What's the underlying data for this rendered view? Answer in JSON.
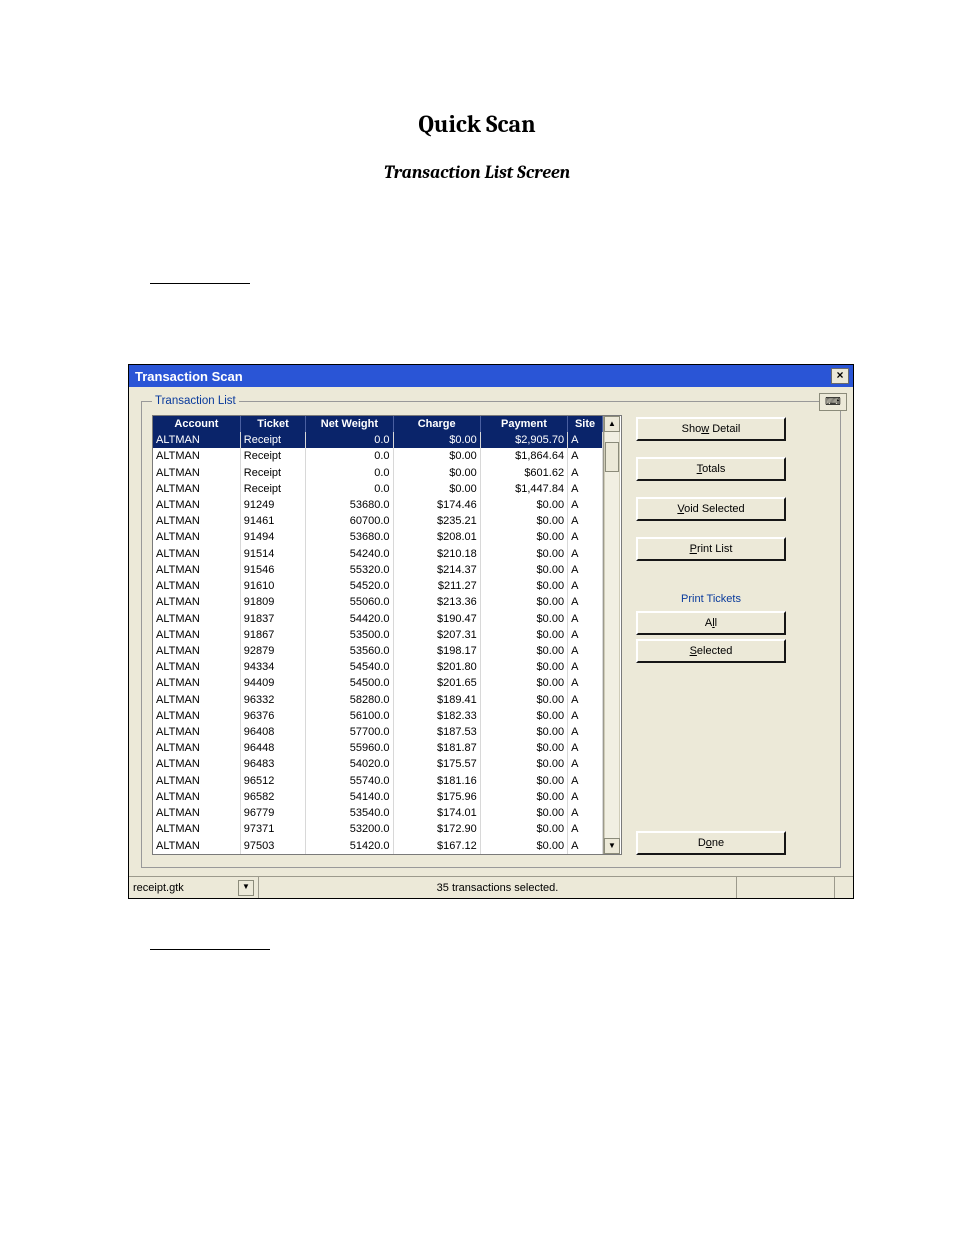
{
  "doc": {
    "title": "Quick Scan",
    "subtitle": "Transaction List Screen"
  },
  "window": {
    "title": "Transaction Scan",
    "close": "×",
    "corner_icon": "⌨"
  },
  "fieldset": {
    "legend": "Transaction List"
  },
  "columns": {
    "account": "Account",
    "ticket": "Ticket",
    "net_weight": "Net Weight",
    "charge": "Charge",
    "payment": "Payment",
    "site": "Site"
  },
  "rows": [
    {
      "account": "ALTMAN",
      "ticket": "Receipt",
      "net_weight": "0.0",
      "charge": "$0.00",
      "payment": "$2,905.70",
      "site": "A",
      "selected": true
    },
    {
      "account": "ALTMAN",
      "ticket": "Receipt",
      "net_weight": "0.0",
      "charge": "$0.00",
      "payment": "$1,864.64",
      "site": "A"
    },
    {
      "account": "ALTMAN",
      "ticket": "Receipt",
      "net_weight": "0.0",
      "charge": "$0.00",
      "payment": "$601.62",
      "site": "A"
    },
    {
      "account": "ALTMAN",
      "ticket": "Receipt",
      "net_weight": "0.0",
      "charge": "$0.00",
      "payment": "$1,447.84",
      "site": "A"
    },
    {
      "account": "ALTMAN",
      "ticket": "91249",
      "net_weight": "53680.0",
      "charge": "$174.46",
      "payment": "$0.00",
      "site": "A"
    },
    {
      "account": "ALTMAN",
      "ticket": "91461",
      "net_weight": "60700.0",
      "charge": "$235.21",
      "payment": "$0.00",
      "site": "A"
    },
    {
      "account": "ALTMAN",
      "ticket": "91494",
      "net_weight": "53680.0",
      "charge": "$208.01",
      "payment": "$0.00",
      "site": "A"
    },
    {
      "account": "ALTMAN",
      "ticket": "91514",
      "net_weight": "54240.0",
      "charge": "$210.18",
      "payment": "$0.00",
      "site": "A"
    },
    {
      "account": "ALTMAN",
      "ticket": "91546",
      "net_weight": "55320.0",
      "charge": "$214.37",
      "payment": "$0.00",
      "site": "A"
    },
    {
      "account": "ALTMAN",
      "ticket": "91610",
      "net_weight": "54520.0",
      "charge": "$211.27",
      "payment": "$0.00",
      "site": "A"
    },
    {
      "account": "ALTMAN",
      "ticket": "91809",
      "net_weight": "55060.0",
      "charge": "$213.36",
      "payment": "$0.00",
      "site": "A"
    },
    {
      "account": "ALTMAN",
      "ticket": "91837",
      "net_weight": "54420.0",
      "charge": "$190.47",
      "payment": "$0.00",
      "site": "A"
    },
    {
      "account": "ALTMAN",
      "ticket": "91867",
      "net_weight": "53500.0",
      "charge": "$207.31",
      "payment": "$0.00",
      "site": "A"
    },
    {
      "account": "ALTMAN",
      "ticket": "92879",
      "net_weight": "53560.0",
      "charge": "$198.17",
      "payment": "$0.00",
      "site": "A"
    },
    {
      "account": "ALTMAN",
      "ticket": "94334",
      "net_weight": "54540.0",
      "charge": "$201.80",
      "payment": "$0.00",
      "site": "A"
    },
    {
      "account": "ALTMAN",
      "ticket": "94409",
      "net_weight": "54500.0",
      "charge": "$201.65",
      "payment": "$0.00",
      "site": "A"
    },
    {
      "account": "ALTMAN",
      "ticket": "96332",
      "net_weight": "58280.0",
      "charge": "$189.41",
      "payment": "$0.00",
      "site": "A"
    },
    {
      "account": "ALTMAN",
      "ticket": "96376",
      "net_weight": "56100.0",
      "charge": "$182.33",
      "payment": "$0.00",
      "site": "A"
    },
    {
      "account": "ALTMAN",
      "ticket": "96408",
      "net_weight": "57700.0",
      "charge": "$187.53",
      "payment": "$0.00",
      "site": "A"
    },
    {
      "account": "ALTMAN",
      "ticket": "96448",
      "net_weight": "55960.0",
      "charge": "$181.87",
      "payment": "$0.00",
      "site": "A"
    },
    {
      "account": "ALTMAN",
      "ticket": "96483",
      "net_weight": "54020.0",
      "charge": "$175.57",
      "payment": "$0.00",
      "site": "A"
    },
    {
      "account": "ALTMAN",
      "ticket": "96512",
      "net_weight": "55740.0",
      "charge": "$181.16",
      "payment": "$0.00",
      "site": "A"
    },
    {
      "account": "ALTMAN",
      "ticket": "96582",
      "net_weight": "54140.0",
      "charge": "$175.96",
      "payment": "$0.00",
      "site": "A"
    },
    {
      "account": "ALTMAN",
      "ticket": "96779",
      "net_weight": "53540.0",
      "charge": "$174.01",
      "payment": "$0.00",
      "site": "A"
    },
    {
      "account": "ALTMAN",
      "ticket": "97371",
      "net_weight": "53200.0",
      "charge": "$172.90",
      "payment": "$0.00",
      "site": "A"
    },
    {
      "account": "ALTMAN",
      "ticket": "97503",
      "net_weight": "51420.0",
      "charge": "$167.12",
      "payment": "$0.00",
      "site": "A"
    }
  ],
  "buttons": {
    "show_detail_pre": "Sho",
    "show_detail_u": "w",
    "show_detail_post": " Detail",
    "totals_u": "T",
    "totals_post": "otals",
    "void_u": "V",
    "void_post": "oid Selected",
    "print_list_u": "P",
    "print_list_post": "rint List",
    "print_tickets_label": "Print Tickets",
    "all_pre": "A",
    "all_u": "l",
    "all_post": "l",
    "selected_u": "S",
    "selected_post": "elected",
    "done_pre": "D",
    "done_u": "o",
    "done_post": "ne"
  },
  "status": {
    "dropdown_value": "receipt.gtk",
    "message": "35 transactions selected."
  },
  "glyphs": {
    "up": "▲",
    "down": "▼"
  }
}
